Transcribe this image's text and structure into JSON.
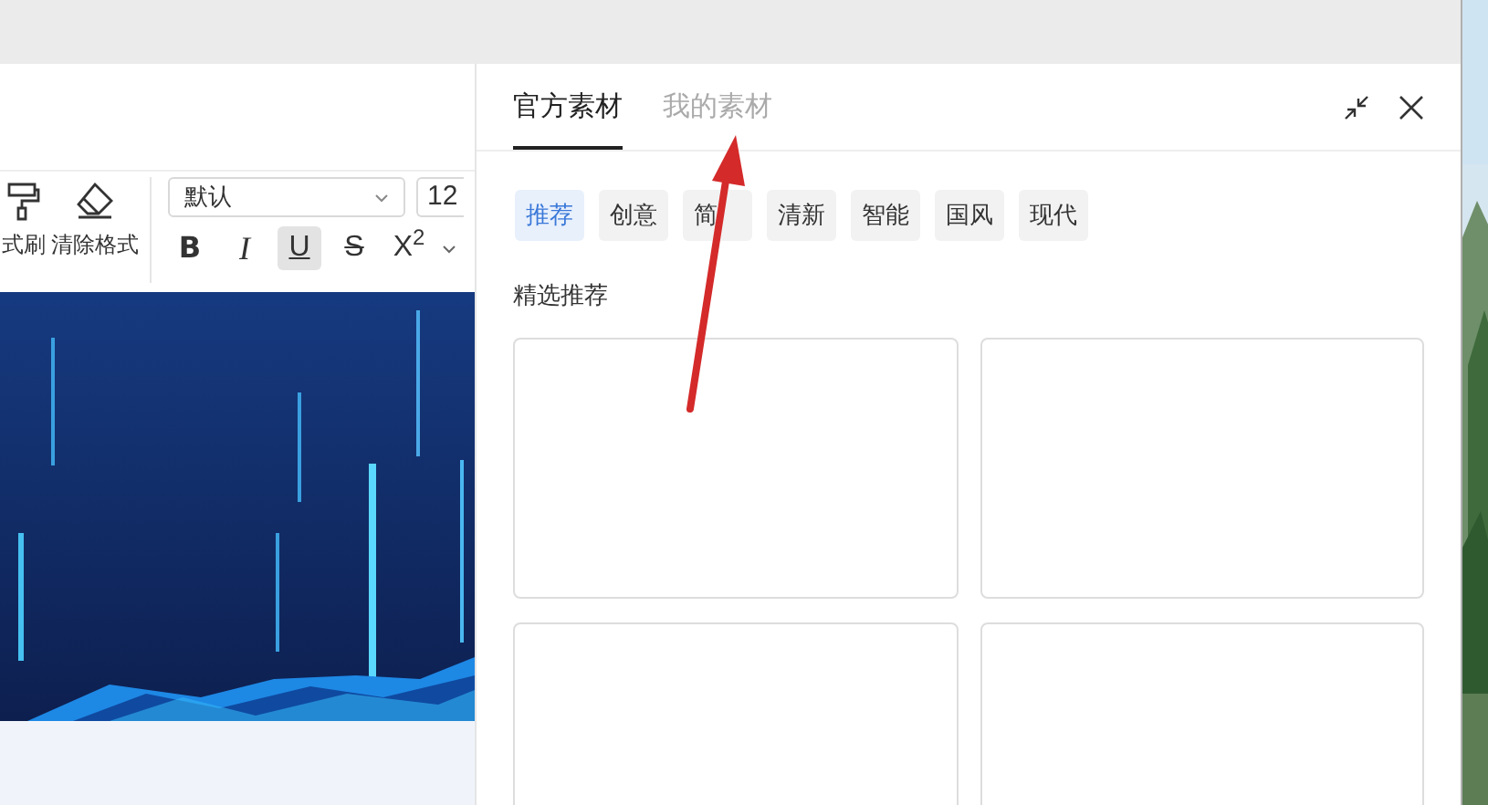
{
  "toolbar": {
    "tools": [
      {
        "kind": "brush",
        "label": "式刷"
      },
      {
        "kind": "eraser",
        "label": "清除格式"
      }
    ],
    "font": {
      "value": "默认"
    },
    "size": {
      "value": "12"
    },
    "format_buttons": [
      {
        "kind": "bold",
        "label": "B",
        "selected": false
      },
      {
        "kind": "italic",
        "label": "I",
        "selected": false
      },
      {
        "kind": "underline",
        "label": "U",
        "selected": true
      },
      {
        "kind": "strike",
        "label": "S",
        "selected": false
      },
      {
        "kind": "superscript",
        "label": "X$^{2}$",
        "selected": false
      }
    ]
  },
  "panel": {
    "tabs": [
      {
        "label": "官方素材",
        "selected": true
      },
      {
        "label": "我的素材",
        "selected": false
      }
    ],
    "tags": [
      {
        "label": "推荐",
        "selected": true
      },
      {
        "label": "创意",
        "selected": false
      },
      {
        "label": "简",
        "selected": false
      },
      {
        "label": "清新",
        "selected": false
      },
      {
        "label": "智能",
        "selected": false
      },
      {
        "label": "国风",
        "selected": false
      },
      {
        "label": "现代",
        "selected": false
      }
    ],
    "section_title": "精选推荐",
    "cards": [
      {
        "kind": "template"
      },
      {
        "kind": "template"
      },
      {
        "kind": "template"
      },
      {
        "kind": "template"
      }
    ]
  },
  "annotation": {
    "kind": "arrow"
  }
}
